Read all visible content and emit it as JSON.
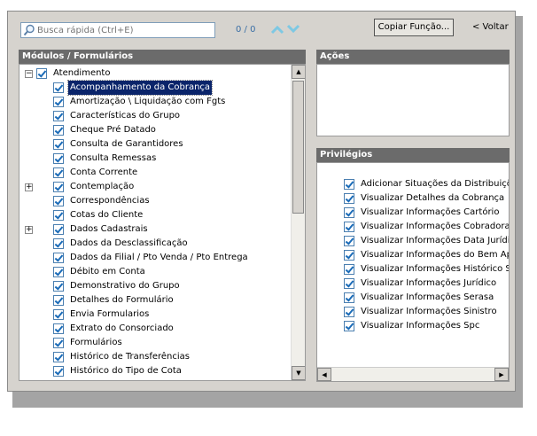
{
  "search": {
    "placeholder": "Busca rápida (Ctrl+E)",
    "counter": "0 / 0"
  },
  "modules": {
    "header": "Módulos / Formulários",
    "root": "Atendimento",
    "items": [
      "Acompanhamento da Cobrança",
      "Amortização \\ Liquidação com Fgts",
      "Características do Grupo",
      "Cheque Pré Datado",
      "Consulta de Garantidores",
      "Consulta Remessas",
      "Conta Corrente",
      "Contemplação",
      "Correspondências",
      "Cotas do Cliente",
      "Dados Cadastrais",
      "Dados da Desclassificação",
      "Dados da Filial / Pto Venda / Pto Entrega",
      "Débito em Conta",
      "Demonstrativo do Grupo",
      "Detalhes do Formulário",
      "Envia Formularios",
      "Extrato do Consorciado",
      "Formulários",
      "Histórico de Transferências",
      "Histórico do Tipo de Cota"
    ]
  },
  "toolbar": {
    "copy_label": "Copiar Função...",
    "back_label": "< Voltar"
  },
  "acoes": {
    "header": "Ações"
  },
  "privilegios": {
    "header": "Privilégios",
    "items": [
      "Adicionar Situações da Distribuiçõ",
      "Visualizar Detalhes da Cobrança",
      "Visualizar Informações Cartório",
      "Visualizar Informações Cobradora",
      "Visualizar Informações Data Jurídic",
      "Visualizar Informações do Bem Apr",
      "Visualizar Informações Histórico Sif",
      "Visualizar Informações Jurídico",
      "Visualizar Informações Serasa",
      "Visualizar Informações Sinistro",
      "Visualizar Informações Spc"
    ]
  },
  "colors": {
    "header_bg": "#6b6b6b",
    "selection": "#0a246a",
    "window_bg": "#d6d3ce",
    "accent_arrows": "#7ec8e3"
  }
}
